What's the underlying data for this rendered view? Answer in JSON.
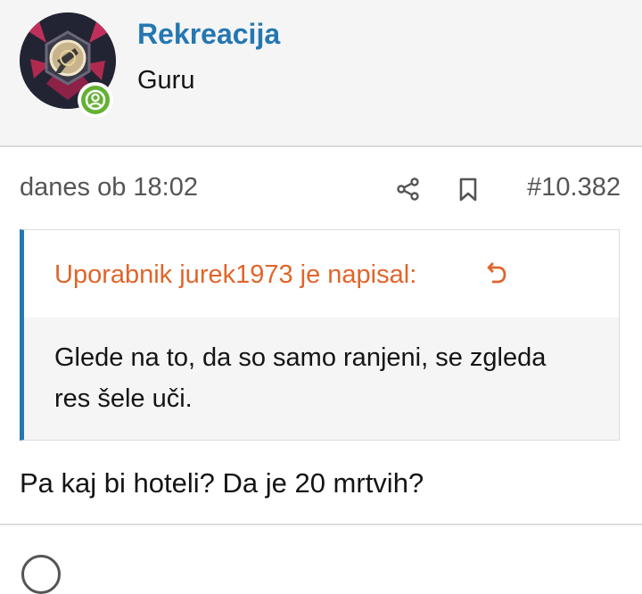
{
  "post": {
    "author": {
      "name": "Rekreacija",
      "title": "Guru",
      "status": "online"
    },
    "meta": {
      "date": "danes ob 18:02",
      "number": "#10.382"
    },
    "icons": {
      "share": "share-icon",
      "bookmark": "bookmark-icon",
      "quote_jump": "arrow-return-icon",
      "online": "user-circle-icon"
    },
    "quote": {
      "header": "Uporabnik jurek1973 je napisal:",
      "text": "Glede na to, da so samo ranjeni, se zgleda res šele uči."
    },
    "body": "Pa kaj bi hoteli? Da je 20 mrtvih?"
  },
  "colors": {
    "link": "#2577b1",
    "quote_author": "#e0652a",
    "online_badge": "#63b133",
    "header_bg": "#f5f5f5"
  }
}
